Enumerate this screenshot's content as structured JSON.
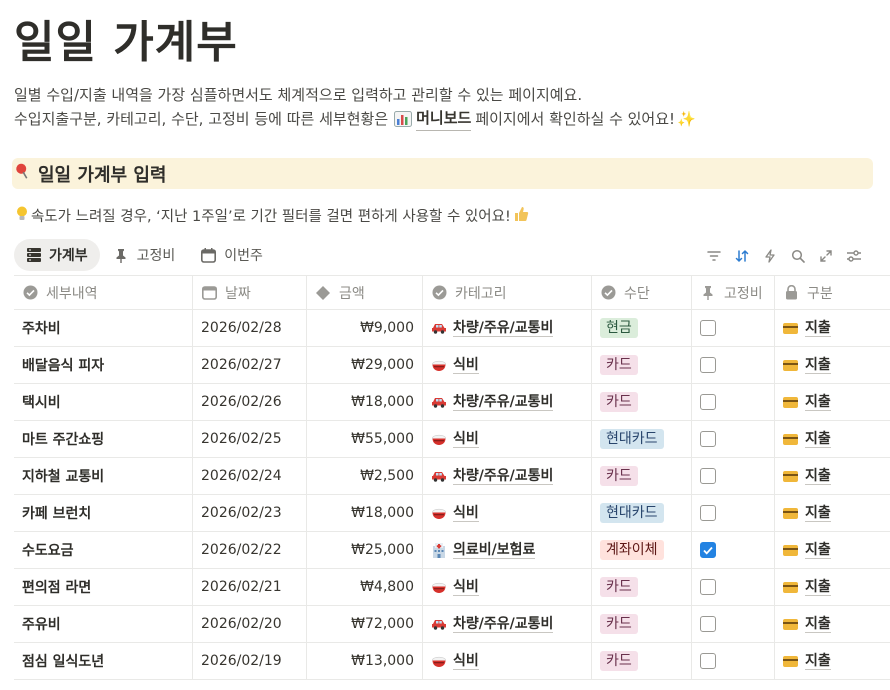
{
  "page": {
    "title": "일일 가계부",
    "desc_line1": "일별 수입/지출 내역을 가장 심플하면서도 체계적으로 입력하고 관리할 수 있는 페이지예요.",
    "desc_line2_pre": "수입지출구분, 카테고리, 수단, 고정비 등에 따른 세부현황은",
    "desc_link": "머니보드",
    "desc_line2_post": "페이지에서 확인하실 수 있어요!",
    "callout_title": "일일 가계부 입력",
    "tip": "속도가 느려질 경우, ‘지난 1주일’로 기간 필터를 걸면 편하게 사용할 수 있어요!"
  },
  "tabs": [
    {
      "label": "가계부",
      "icon": "table-icon",
      "active": true
    },
    {
      "label": "고정비",
      "icon": "pin-icon",
      "active": false
    },
    {
      "label": "이번주",
      "icon": "calendar-icon",
      "active": false
    }
  ],
  "toolbar": [
    "filter-icon",
    "sort-icon",
    "lightning-icon",
    "search-icon",
    "expand-icon",
    "settings-icon"
  ],
  "columns": {
    "detail": "세부내역",
    "date": "날짜",
    "amount": "금액",
    "category": "카테고리",
    "method": "수단",
    "fixed": "고정비",
    "type": "구분"
  },
  "rows": [
    {
      "detail": "주차비",
      "date": "2026/02/28",
      "amount": "₩9,000",
      "category": "차량/주유/교통비",
      "cat_icon": "car-icon",
      "method": "현금",
      "fixed": false,
      "type": "지출"
    },
    {
      "detail": "배달음식 피자",
      "date": "2026/02/27",
      "amount": "₩29,000",
      "category": "식비",
      "cat_icon": "rice-bowl-icon",
      "method": "카드",
      "fixed": false,
      "type": "지출"
    },
    {
      "detail": "택시비",
      "date": "2026/02/26",
      "amount": "₩18,000",
      "category": "차량/주유/교통비",
      "cat_icon": "car-icon",
      "method": "카드",
      "fixed": false,
      "type": "지출"
    },
    {
      "detail": "마트 주간쇼핑",
      "date": "2026/02/25",
      "amount": "₩55,000",
      "category": "식비",
      "cat_icon": "rice-bowl-icon",
      "method": "현대카드",
      "fixed": false,
      "type": "지출"
    },
    {
      "detail": "지하철 교통비",
      "date": "2026/02/24",
      "amount": "₩2,500",
      "category": "차량/주유/교통비",
      "cat_icon": "car-icon",
      "method": "카드",
      "fixed": false,
      "type": "지출"
    },
    {
      "detail": "카페 브런치",
      "date": "2026/02/23",
      "amount": "₩18,000",
      "category": "식비",
      "cat_icon": "rice-bowl-icon",
      "method": "현대카드",
      "fixed": false,
      "type": "지출"
    },
    {
      "detail": "수도요금",
      "date": "2026/02/22",
      "amount": "₩25,000",
      "category": "의료비/보험료",
      "cat_icon": "hospital-icon",
      "method": "계좌이체",
      "fixed": true,
      "type": "지출"
    },
    {
      "detail": "편의점 라면",
      "date": "2026/02/21",
      "amount": "₩4,800",
      "category": "식비",
      "cat_icon": "rice-bowl-icon",
      "method": "카드",
      "fixed": false,
      "type": "지출"
    },
    {
      "detail": "주유비",
      "date": "2026/02/20",
      "amount": "₩72,000",
      "category": "차량/주유/교통비",
      "cat_icon": "car-icon",
      "method": "카드",
      "fixed": false,
      "type": "지출"
    },
    {
      "detail": "점심 일식도년",
      "date": "2026/02/19",
      "amount": "₩13,000",
      "category": "식비",
      "cat_icon": "rice-bowl-icon",
      "method": "카드",
      "fixed": false,
      "type": "지출"
    }
  ],
  "method_colors": {
    "현금": {
      "bg": "#dbeddb",
      "fg": "#2b593f"
    },
    "카드": {
      "bg": "#f5e0e9",
      "fg": "#69314c"
    },
    "현대카드": {
      "bg": "#d3e5ef",
      "fg": "#28456c"
    },
    "계좌이체": {
      "bg": "#ffe2dd",
      "fg": "#5d1715"
    }
  }
}
